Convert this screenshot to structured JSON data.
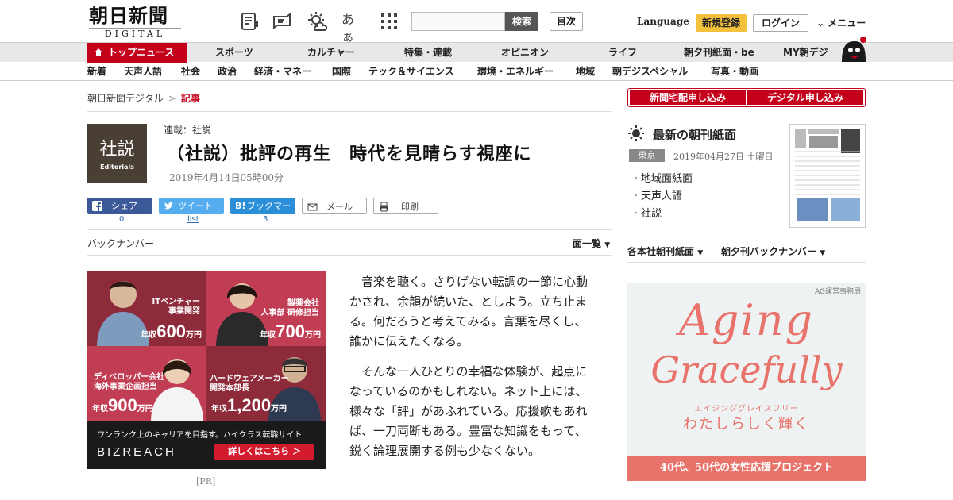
{
  "header": {
    "logo_ja": "朝日新聞",
    "logo_en": "DIGITAL",
    "search_button": "検索",
    "search_placeholder": "",
    "toc": "目次",
    "language": "Language",
    "register": "新規登録",
    "login": "ログイン",
    "menu": "メニュー",
    "icons": [
      "newspaper-icon",
      "chat-icon",
      "weather-icon",
      "font-size-icon",
      "grid-icon"
    ],
    "font_size_label": "あぁ"
  },
  "nav_primary": {
    "top": "トップニュース",
    "items": [
      "スポーツ",
      "カルチャー",
      "特集・連載",
      "オピニオン",
      "ライフ",
      "朝夕刊紙面・be",
      "MY朝デジ"
    ]
  },
  "nav_secondary": [
    "新着",
    "天声人語",
    "社会",
    "政治",
    "経済・マネー",
    "国際",
    "テック＆サイエンス",
    "環境・エネルギー",
    "地域",
    "朝デジスペシャル",
    "写真・動画"
  ],
  "breadcrumb": {
    "home": "朝日新聞デジタル",
    "sep": ">",
    "current": "記事"
  },
  "article": {
    "badge_ja": "社説",
    "badge_en": "Editorials",
    "series": "連載：社説",
    "title": "（社説）批評の再生　時代を見晴らす視座に",
    "date": "2019年4月14日05時00分",
    "share": [
      {
        "label": "シェア",
        "count": "0"
      },
      {
        "label": "ツイート",
        "count": "list"
      },
      {
        "label": "ブックマーク",
        "count": "3"
      },
      {
        "label": "メール",
        "count": ""
      },
      {
        "label": "印刷",
        "count": ""
      }
    ],
    "back_number": "バックナンバー",
    "page_list": "面一覧",
    "paragraphs": [
      "音楽を聴く。さりげない転調の一節に心動かされ、余韻が続いた、としよう。立ち止まる。何だろうと考えてみる。言葉を尽くし、誰かに伝えたくなる。",
      "そんな一人ひとりの幸福な体験が、起点になっているのかもしれない。ネット上には、様々な「評」があふれている。応援歌もあれば、一刀両断もある。豊富な知識をもって、鋭く論理展開する例も少なくない。"
    ]
  },
  "ad_left": {
    "pr": "[PR]",
    "q1_label": "ITベンチャー\n事業開発",
    "q1_pre": "年収",
    "q1_num": "600",
    "q1_unit": "万円",
    "q2_label": "製薬会社\n人事部 研修担当",
    "q2_pre": "年収",
    "q2_num": "700",
    "q2_unit": "万円",
    "q3_label": "ディベロッパー会社\n海外事業企画担当",
    "q3_pre": "年収",
    "q3_num": "900",
    "q3_unit": "万円",
    "q4_label": "ハードウェアメーカー\n開発本部長",
    "q4_pre": "年収",
    "q4_num": "1,200",
    "q4_unit": "万円",
    "tagline": "ワンランク上のキャリアを目指す。ハイクラス転職サイト",
    "brand": "BIZREACH",
    "cta": "詳しくはこちら ＞"
  },
  "sidebar": {
    "subscribe_paper": "新聞宅配申し込み",
    "subscribe_digital": "デジタル申し込み",
    "morning_title": "最新の朝刊紙面",
    "edition": "東京",
    "edition_date": "2019年04月27日 土曜日",
    "links": [
      "地域面紙面",
      "天声人語",
      "社説"
    ],
    "dropdown1": "各本社朝刊紙面",
    "dropdown2": "朝夕刊バックナンバー"
  },
  "ad_right": {
    "sponsor": "AG運営事務局",
    "line1": "Aging",
    "line2": "Gracefully",
    "kana": "エイジンググレイスフリー",
    "sub": "わたしらしく輝く",
    "footer": "40代、50代の女性応援プロジェクト",
    "accent": "#e8736a"
  }
}
